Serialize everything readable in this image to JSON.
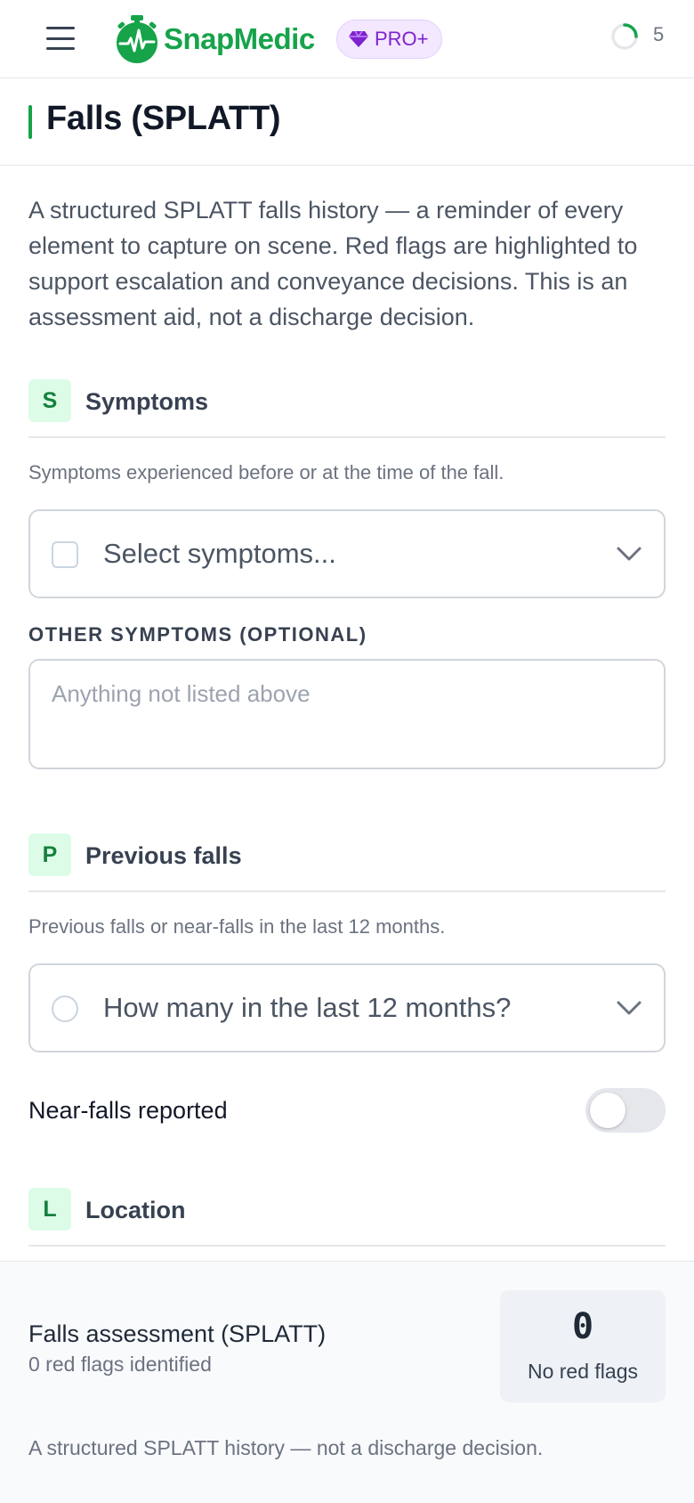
{
  "app": {
    "name": "SnapMedic",
    "badge": "PRO+",
    "notification_count": "5",
    "brand_color": "#16a34a",
    "badge_color": "#7e22ce"
  },
  "page": {
    "title": "Falls (SPLATT)",
    "intro": "A structured SPLATT falls history — a reminder of every element to capture on scene. Red flags are highlighted to support escalation and conveyance decisions. This is an assessment aid, not a discharge decision."
  },
  "sections": {
    "symptoms": {
      "letter": "S",
      "title": "Symptoms",
      "description": "Symptoms experienced before or at the time of the fall.",
      "select_placeholder": "Select symptoms...",
      "other_label": "OTHER SYMPTOMS (OPTIONAL)",
      "other_placeholder": "Anything not listed above"
    },
    "previous_falls": {
      "letter": "P",
      "title": "Previous falls",
      "description": "Previous falls or near-falls in the last 12 months.",
      "select_placeholder": "How many in the last 12 months?",
      "toggle_label": "Near-falls reported",
      "toggle_on": false
    },
    "location": {
      "letter": "L",
      "title": "Location"
    }
  },
  "footer": {
    "title": "Falls assessment (SPLATT)",
    "subtitle": "0 red flags identified",
    "red_flag_count": "0",
    "red_flag_label": "No red flags",
    "note": "A structured SPLATT history — not a discharge decision."
  },
  "icons": {
    "menu": "hamburger-icon",
    "logo": "stopwatch-heartbeat-icon",
    "badge": "gem-icon",
    "status": "spinner-icon",
    "dropdown": "chevron-down-icon"
  }
}
